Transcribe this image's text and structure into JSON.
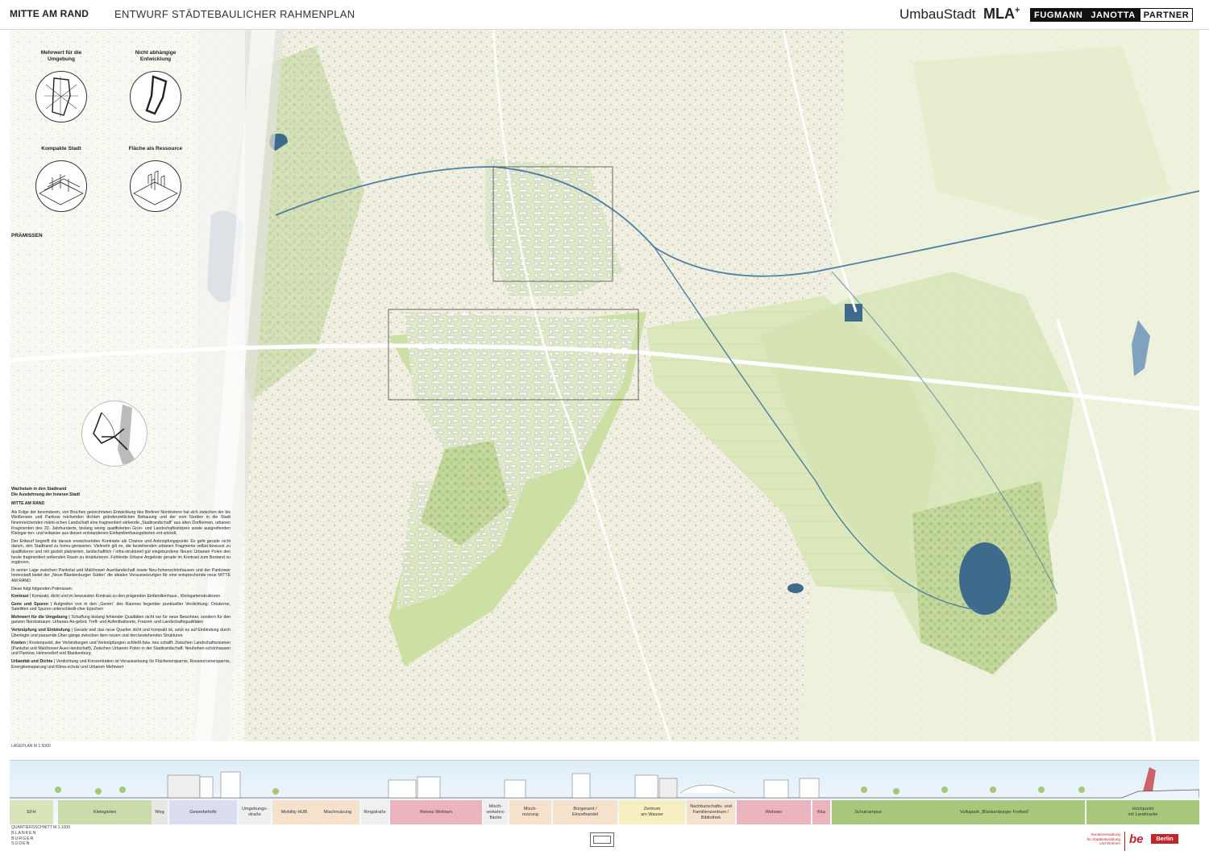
{
  "header": {
    "title": "MITTE AM RAND",
    "subtitle": "ENTWURF STÄDTEBAULICHER RAHMENPLAN",
    "logo_umbau": "UmbauStadt",
    "logo_mla": "MLA",
    "logo_mla_sup": "+",
    "logo_fjp": [
      "FUGMANN",
      "JANOTTA",
      "PARTNER"
    ]
  },
  "diagrams": {
    "d1": "Mehrwert für die Umgebung",
    "d2": "Nicht abhängige Entwicklung",
    "d3": "Kompakte Stadt",
    "d4": "Fläche als Ressource"
  },
  "praemissen": "PRÄMISSEN",
  "text": {
    "head1": "Wachstum in den Stadtrand",
    "head2": "Die Ausdehnung der Inneren Stadt",
    "head3": "MITTE AM RAND",
    "p1": "Als Folge der besonderen, von Brüchen gezeichneten Entwicklung des Berliner Nordostens hat sich zwischen der bis Weißensee und Pankow reichenden dichten gründerzeitlichen Bebauung und der vom Norden in die Stadt hineinreichenden märki-schen Landschaft eine fragmentiert wirkende „Stadtrandschaft“ aus alten Dorfkernen, urbanen Fragmenten des 20. Jahrhunderts, bislang wenig qualifizierten Grün- und Landschaftsstützen sowie ausgreifenden Kleingar-ten- und teilweise aus diesen entstandenen Einfamilienhausgebieten ent-wickelt.",
    "p2": "Der Entwurf begreift die daraus erwachsenden Kontraste als Chance und Anknüpfungspunkt: Es geht gerade nicht darum, den Stadtrand zu homo-genisieren. Vielmehr gilt es, die bestehenden urbanen Fragmente selbst-bewusst zu qualifizieren und mit gezielt platzierten, landschaftlich / infra-strukturell gut eingebundene Neuen Urbanen Polen den heute fragmentiert wirkenden Raum zu strukturieren. Fehlende Urbane Angebote gerade im Kontrast zum Bestand zu ergänzen.",
    "p3": "In seiner Lage zwischen Pankztal und Malchower Auenlandschaft sowie Neu-hohenschönhausen und der Pankower Innenstadt bietet der „Neue Blankenburger Süden“ die idealen Voraussetzungen für eine entsprechende neue MITTE AM RAND.",
    "p4": "Diese folgt folgenden Prämissen:",
    "items": [
      {
        "k": "Kontrast",
        "v": " | Kompakt, dicht und im bewussten Kontrast zu den prägenden Einfamilienhaus-, Kleingartenstrukturen"
      },
      {
        "k": "Gene und Spuren",
        "v": " | Aufgreifen von in den „Genen“ des Raumes liegender punktueller Verdichtung: Ortskerne, Satelliten und Spuren unterschiedli-cher Epochen"
      },
      {
        "k": "Mehrwert für die Umgebung",
        "v": " | Schaffung bislang fehlender Qualitäten nicht nur für neue Bewohner, sondern für den ganzen Nordostraum: Urbanes An-gebot, Treff- und Aufenthaltsorte, Freizeit- und Landschaftsqualitäten"
      },
      {
        "k": "Verknüpfung und Einbindung",
        "v": " | Gerade weil das neue Quartier dicht und kompakt ist, setzt es auf Einbindung durch Überlegte und passende Über-gänge zwischen dem neuen und den bestehenden Strukturen"
      },
      {
        "k": "Knoten",
        "v": " | Knotenpunkt, der Verbindungen und Verknüpfungen schließt bzw. neu schafft: Zwischen Landschaftsräumen (Pankztal und Malchower Auen-landschaft), Zwischen Urbanen Polen in der Stadtrandschaft: Neuhohen-schönhausen und Pankow, Heinersdorf und Blankenburg"
      },
      {
        "k": "Urbanität und Dichte",
        "v": " | Verdichtung und Konzentration ist Voraussetzung für Flächenersparnis, Ressourcenersparnis, Energieeinsparung und Klima-schutz und Urbanen Mehrwert"
      }
    ]
  },
  "lageplan": "LAGEPLAN M 1:5000",
  "section_zones": [
    {
      "label": "EFH",
      "color": "#d9e4b8"
    },
    {
      "label": "Kleingärten",
      "color": "#c9dcaa"
    },
    {
      "label": "Weg",
      "color": "#e8e8e0"
    },
    {
      "label": "Gewerbehöfe",
      "color": "#dcdcf0"
    },
    {
      "label": "Umgebungs-\nstraße",
      "color": "#efefef"
    },
    {
      "label": "Mobility HUB",
      "color": "#f6e2cc"
    },
    {
      "label": "Mischnutzung",
      "color": "#f6e2cc"
    },
    {
      "label": "Ringstraße",
      "color": "#efefef"
    },
    {
      "label": "Reines Wohnen",
      "color": "#ecb4bd"
    },
    {
      "label": "Misch-\nverkehrs-\nfläche",
      "color": "#efefef"
    },
    {
      "label": "Misch-\nnutzung",
      "color": "#f6e2cc"
    },
    {
      "label": "Bürgeramt /\nEinzelhandel",
      "color": "#f6e2cc"
    },
    {
      "label": "Zentrum\nam Wasser",
      "color": "#f8efc0"
    },
    {
      "label": "Nachbarschafts- und\nFamilienzentrum /\nBibliothek",
      "color": "#f6e2cc"
    },
    {
      "label": "Wohnen",
      "color": "#ecb4bd"
    },
    {
      "label": "Kita",
      "color": "#ecb4bd"
    },
    {
      "label": "Schulcampus",
      "color": "#a8c77a"
    },
    {
      "label": "Volkspark „Blankenburger Freiheit“",
      "color": "#a8c77a"
    },
    {
      "label": "Hochpunkt\nmit Landmarke",
      "color": "#a8c77a"
    }
  ],
  "quartier": "QUARTIERSSCHNITT M 1:1000",
  "blanken": [
    "BLANKEN",
    "BURGER",
    "SÜDEN"
  ],
  "senat": [
    "Senatsverwaltung",
    "für Stadtentwicklung",
    "und Wohnen"
  ],
  "be_logo": "be",
  "berlin": "Berlin",
  "colors": {
    "accent_red": "#c0262d",
    "water": "#3e6a8c",
    "green": "#a8c77a"
  }
}
